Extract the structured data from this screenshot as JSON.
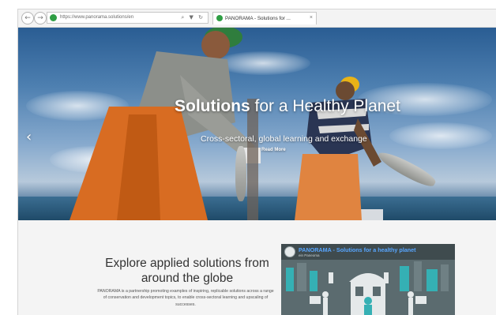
{
  "browser": {
    "nav_back_icon": "back-arrow-icon",
    "nav_forward_icon": "forward-arrow-icon",
    "url": "https://www.panorama.solutions/en",
    "address_tools": "⌕ ▼ ↻",
    "tab_title": "PANORAMA - Solutions for ...",
    "tab_close": "×"
  },
  "hero": {
    "title_strong": "Solutions",
    "title_rest": " for a Healthy Planet",
    "subtitle": "Cross-sectoral, global learning and exchange",
    "read_more": "Read More",
    "prev_arrow": "‹"
  },
  "intro": {
    "title": "Explore applied solutions from around the globe",
    "body": "PANORAMA is a partnership promoting examples of inspiring, replicable solutions across a range of conservation and development topics, to enable cross-sectoral learning and upscaling of successes."
  },
  "video": {
    "title": "PANORAMA - Solutions for a healthy planet",
    "channel": "ein Paneoma"
  },
  "colors": {
    "accent": "#58a6ff",
    "brand_green": "#2f9e44",
    "video_teal": "#35b0b4"
  }
}
